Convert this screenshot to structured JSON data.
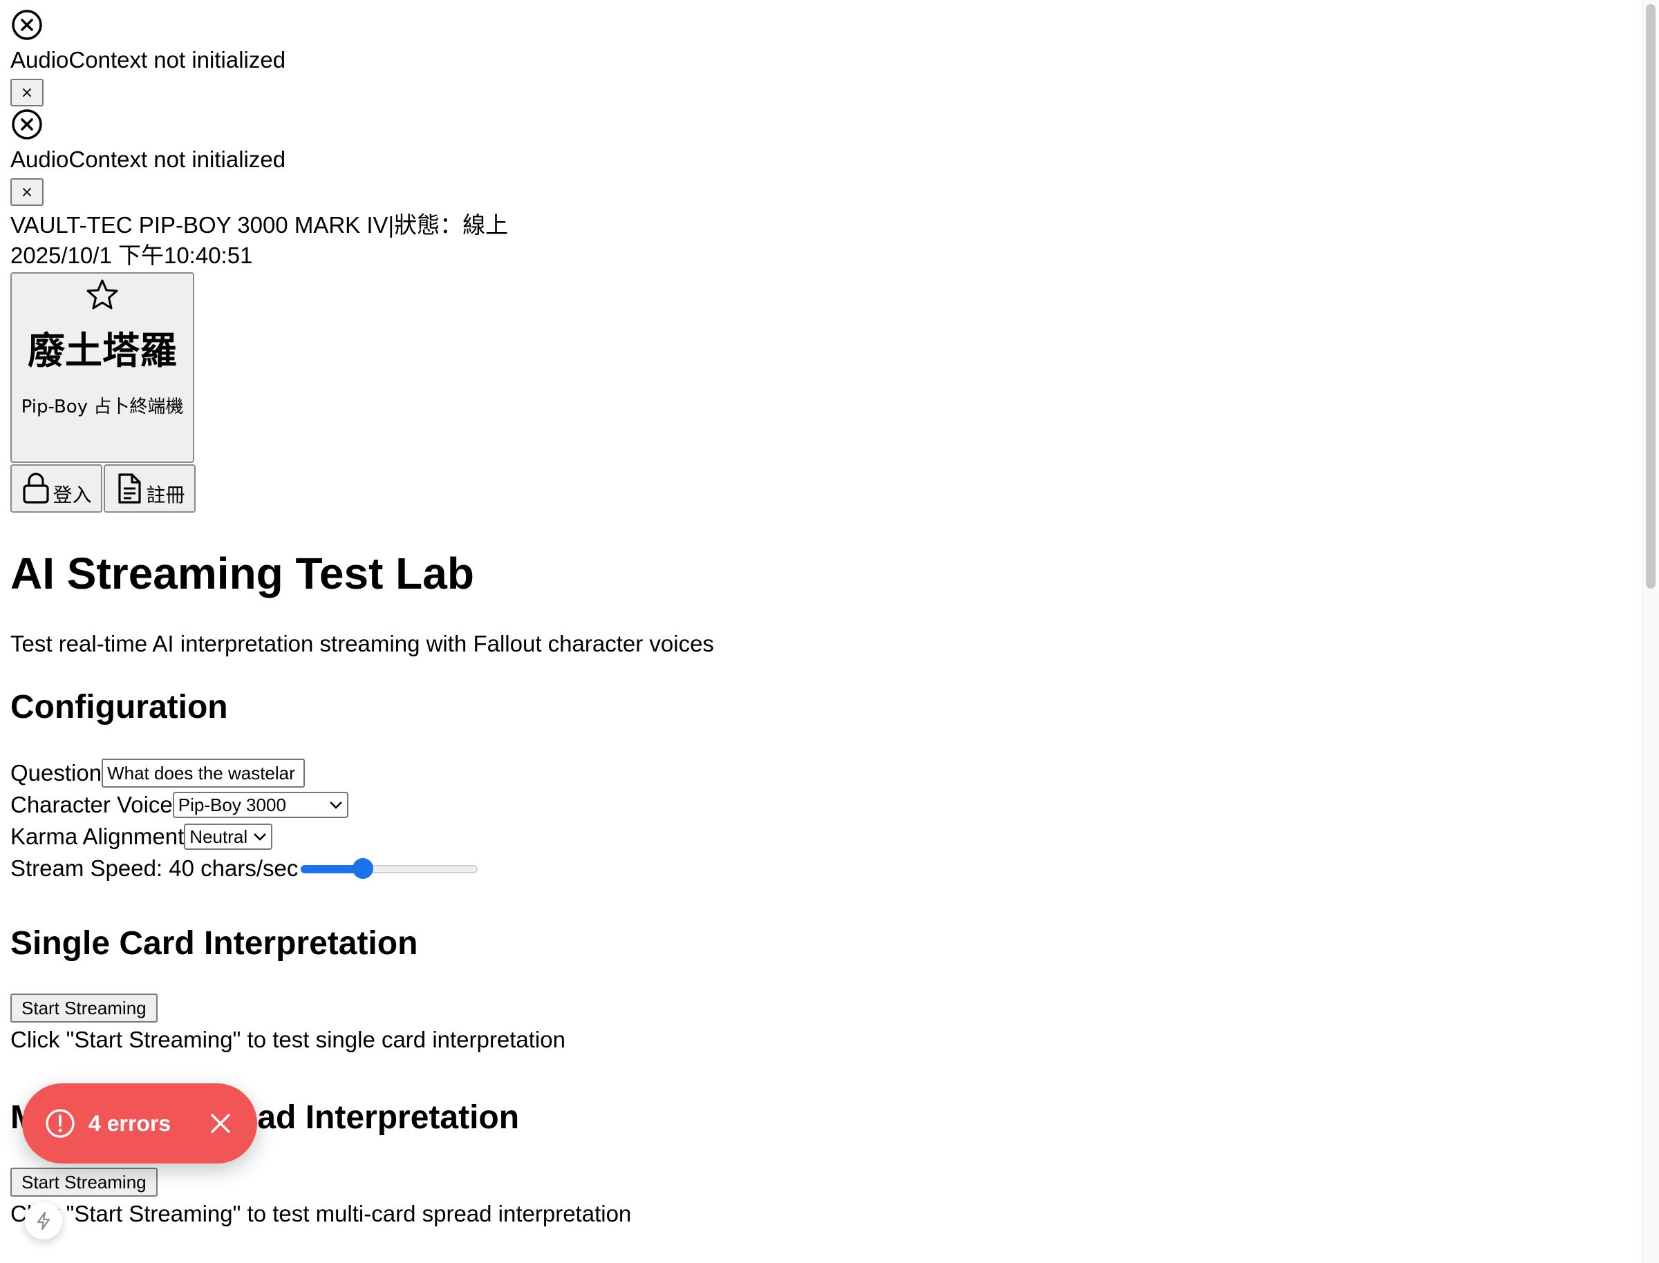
{
  "errors_top": [
    {
      "icon": "circle-x-icon",
      "message": "AudioContext not initialized",
      "close": "×"
    },
    {
      "icon": "circle-x-icon",
      "message": "AudioContext not initialized",
      "close": "×"
    }
  ],
  "status_bar": {
    "vault_line": "VAULT-TEC PIP-BOY 3000 MARK IV|狀態：線上",
    "datetime": "2025/10/1 下午10:40:51"
  },
  "logo": {
    "icon": "star-icon",
    "title": "廢土塔羅",
    "subtitle": "Pip-Boy 占卜終端機"
  },
  "auth": {
    "login_label": "登入",
    "login_icon": "lock-icon",
    "register_label": "註冊",
    "register_icon": "document-icon"
  },
  "page": {
    "title": "AI Streaming Test Lab",
    "description": "Test real-time AI interpretation streaming with Fallout character voices"
  },
  "config": {
    "heading": "Configuration",
    "question_label": "Question",
    "question_value": "What does the wastelar",
    "character_label": "Character Voice",
    "character_value": "Pip-Boy 3000",
    "karma_label": "Karma Alignment",
    "karma_value": "Neutral",
    "speed_label": "Stream Speed: 40 chars/sec",
    "speed_fraction": 0.35
  },
  "single": {
    "heading": "Single Card Interpretation",
    "button": "Start Streaming",
    "hint": "Click \"Start Streaming\" to test single card interpretation"
  },
  "multi": {
    "heading": "Multi-Card Spread Interpretation",
    "button": "Start Streaming",
    "hint": "Click \"Start Streaming\" to test multi-card spread interpretation"
  },
  "toast": {
    "label": "4 errors",
    "color": "#f25555"
  },
  "colors": {
    "accent": "#1a73e8"
  }
}
